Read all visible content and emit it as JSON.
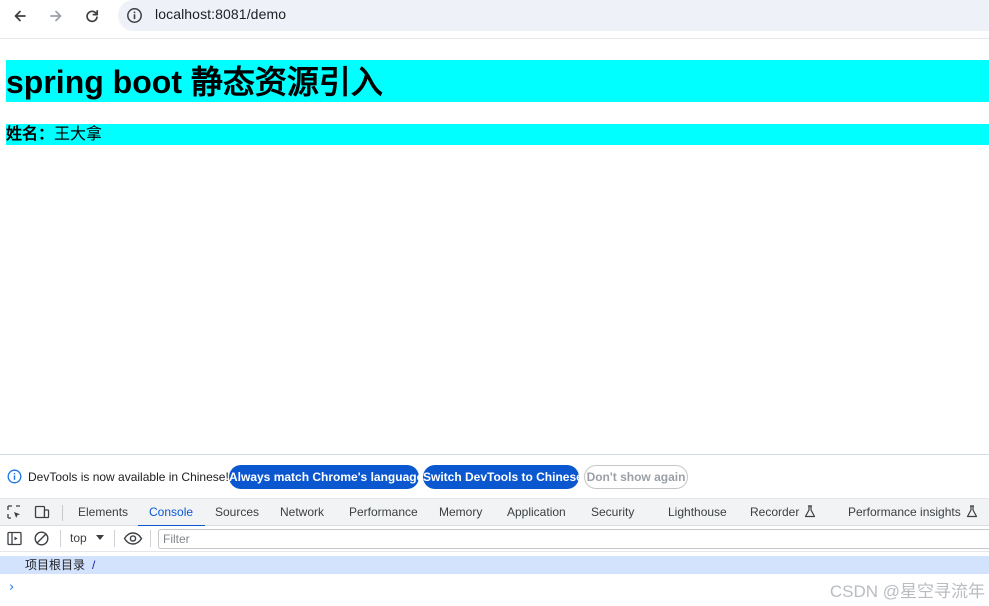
{
  "browser": {
    "url": "localhost:8081/demo"
  },
  "page": {
    "heading": "spring boot 静态资源引入",
    "para_label": "姓名：",
    "para_value": "王大拿"
  },
  "devtools": {
    "notice": {
      "text": "DevTools is now available in Chinese!",
      "btn_match": "Always match Chrome's language",
      "btn_switch": "Switch DevTools to Chinese",
      "btn_dismiss": "Don't show again"
    },
    "tabs": [
      "Elements",
      "Console",
      "Sources",
      "Network",
      "Performance",
      "Memory",
      "Application",
      "Security",
      "Lighthouse",
      "Recorder",
      "Performance insights"
    ],
    "active_tab": "Console",
    "context": "top",
    "filter_placeholder": "Filter",
    "console_message": "项目根目录",
    "console_arg": "/"
  },
  "watermark": "CSDN @星空寻流年",
  "colors": {
    "page_highlight": "#00ffff",
    "accent": "#0b57d0",
    "console_row": "#d3e3fd"
  }
}
